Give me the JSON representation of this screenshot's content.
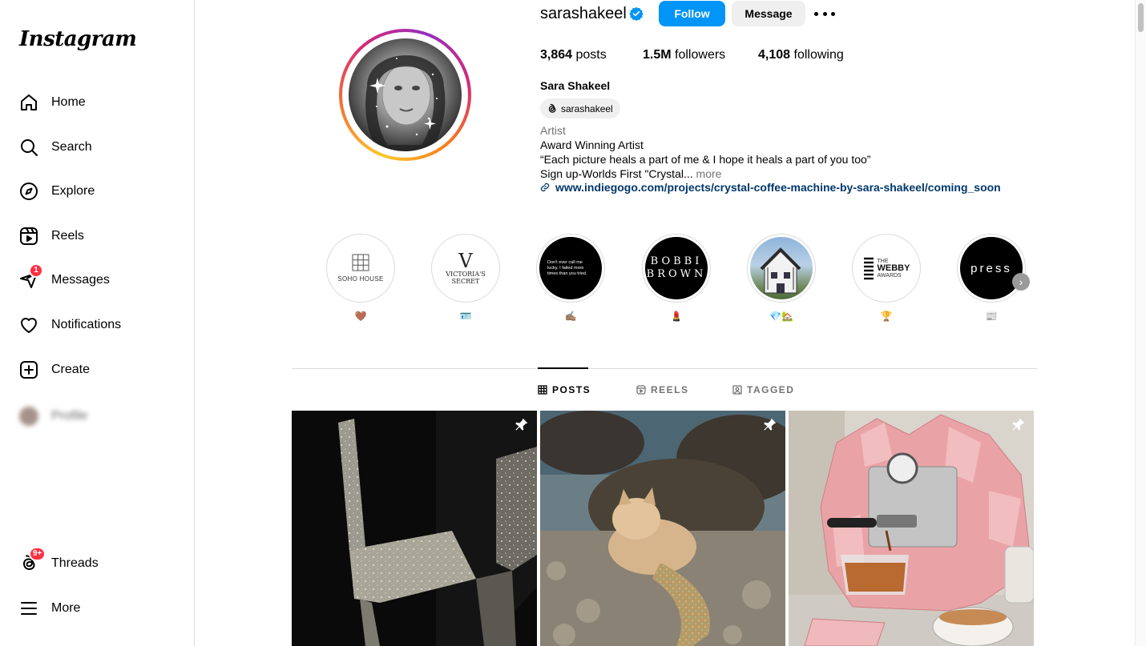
{
  "brand": {
    "logo_text": "Instagram"
  },
  "sidebar": {
    "items": [
      {
        "label": "Home",
        "icon": "home-icon"
      },
      {
        "label": "Search",
        "icon": "search-icon"
      },
      {
        "label": "Explore",
        "icon": "compass-icon"
      },
      {
        "label": "Reels",
        "icon": "reels-icon"
      },
      {
        "label": "Messages",
        "icon": "messenger-icon",
        "badge": "1"
      },
      {
        "label": "Notifications",
        "icon": "heart-icon"
      },
      {
        "label": "Create",
        "icon": "plus-square-icon"
      },
      {
        "label": "Profile",
        "icon": "avatar"
      }
    ],
    "bottom": [
      {
        "label": "Threads",
        "icon": "threads-icon",
        "badge": "9+"
      },
      {
        "label": "More",
        "icon": "menu-icon"
      }
    ]
  },
  "profile": {
    "username": "sarashakeel",
    "follow_label": "Follow",
    "message_label": "Message",
    "stats": {
      "posts_count": "3,864",
      "posts_label": "posts",
      "followers_count": "1.5M",
      "followers_label": "followers",
      "following_count": "4,108",
      "following_label": "following"
    },
    "full_name": "Sara Shakeel",
    "threads_handle": "sarashakeel",
    "category": "Artist",
    "bio_line1": "Award Winning Artist",
    "bio_line2": "“Each picture heals a part of me & I hope it heals a part of you too”",
    "bio_line3": "Sign up-Worlds First \"Crystal...",
    "bio_more": "more",
    "link": "www.indiegogo.com/projects/crystal-coffee-machine-by-sara-shakeel/coming_soon"
  },
  "highlights": [
    {
      "caption": "🤎",
      "cover_text": "SOHO HOUSE"
    },
    {
      "caption": "🪪",
      "cover_text": "VICTORIA'S SECRET"
    },
    {
      "caption": "✍🏽",
      "cover_text": "Don't ever call me lucky. I failed more times than you tried."
    },
    {
      "caption": "💄",
      "cover_text": "BOBBI BROWN"
    },
    {
      "caption": "💎🏡",
      "cover_text": ""
    },
    {
      "caption": "🏆",
      "cover_text_top": "THE",
      "cover_text_mid": "WEBBY",
      "cover_text_bot": "AWARDS"
    },
    {
      "caption": "📰",
      "cover_text": "press"
    }
  ],
  "tabs": [
    {
      "label": "POSTS",
      "icon": "grid-icon",
      "active": true
    },
    {
      "label": "REELS",
      "icon": "reels-icon",
      "active": false
    },
    {
      "label": "TAGGED",
      "icon": "tag-icon",
      "active": false
    }
  ],
  "posts": [
    {
      "subject": "crystal-chair",
      "pinned": true
    },
    {
      "subject": "crystal-mermaid-cat",
      "pinned": true
    },
    {
      "subject": "crystal-coffee-machine",
      "pinned": true
    }
  ],
  "colors": {
    "accent_blue": "#0095f6",
    "link_blue": "#00376b",
    "badge_red": "#ff3040",
    "secondary_text": "#737373"
  }
}
